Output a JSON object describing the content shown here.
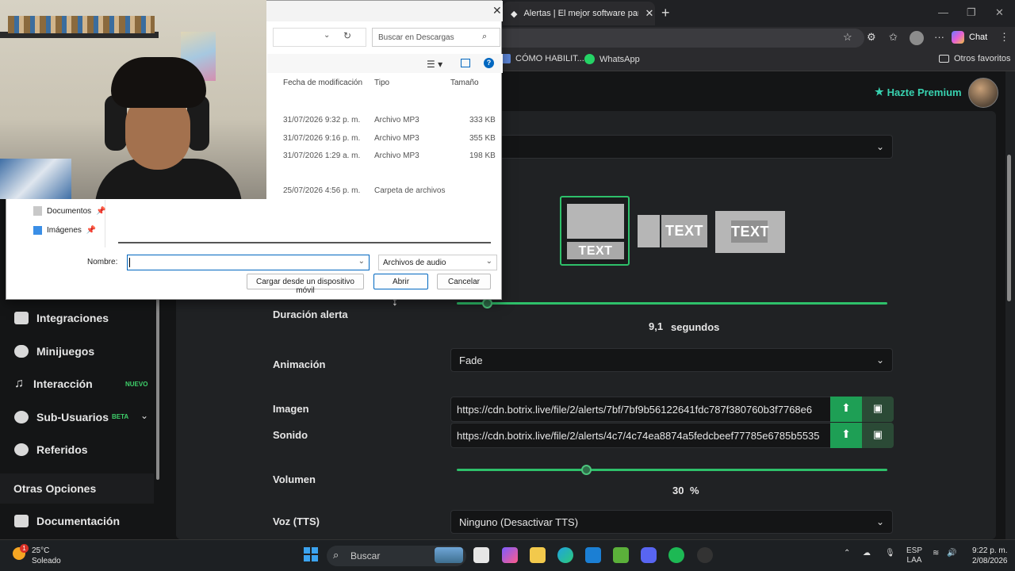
{
  "browser": {
    "tab_title": "Alertas | El mejor software para po",
    "bookmarks": [
      "CÓMO HABILIT...",
      "WhatsApp"
    ],
    "other_favorites": "Otros favoritos",
    "chat_label": "Chat"
  },
  "header": {
    "premium_label": "Hazte Premium"
  },
  "sidebar": {
    "items": [
      {
        "label": "Integraciones"
      },
      {
        "label": "Minijuegos"
      },
      {
        "label": "Interacción"
      },
      {
        "label": "Sub-Usuarios"
      },
      {
        "label": "Referidos"
      }
    ],
    "nuevo_badge": "NUEVO",
    "beta_badge": "BETA",
    "section_title": "Otras Opciones",
    "doc_item": "Documentación"
  },
  "layout_options": {
    "text_label": "TEXT"
  },
  "form": {
    "duracion_label": "Duración alerta",
    "duracion_value": "9,1",
    "duracion_unit": "segundos",
    "duracion_fraction": 0.07,
    "animacion_label": "Animación",
    "animacion_value": "Fade",
    "imagen_label": "Imagen",
    "imagen_url": "https://cdn.botrix.live/file/2/alerts/7bf/7bf9b56122641fdc787f380760b3f7768e6",
    "sonido_label": "Sonido",
    "sonido_url": "https://cdn.botrix.live/file/2/alerts/4c7/4c74ea8874a5fedcbeef77785e6785b5535",
    "volumen_label": "Volumen",
    "volumen_value": "30",
    "volumen_unit": "%",
    "volumen_fraction": 0.3,
    "voz_label": "Voz (TTS)",
    "voz_value": "Ninguno (Desactivar TTS)"
  },
  "dialog": {
    "search_placeholder": "Buscar en Descargas",
    "columns": [
      "Fecha de modificación",
      "Tipo",
      "Tamaño"
    ],
    "rows": [
      {
        "date": "31/07/2026 9:32 p. m.",
        "type": "Archivo MP3",
        "size": "333 KB"
      },
      {
        "date": "31/07/2026 9:16 p. m.",
        "type": "Archivo MP3",
        "size": "355 KB"
      },
      {
        "date": "31/07/2026 1:29 a. m.",
        "type": "Archivo MP3",
        "size": "198 KB"
      },
      {
        "date": "25/07/2026 4:56 p. m.",
        "type": "Carpeta de archivos",
        "size": ""
      }
    ],
    "nav": [
      "Documentos",
      "Imágenes"
    ],
    "name_label": "Nombre:",
    "name_value": "",
    "filetype": "Archivos de audio",
    "mobile_button": "Cargar desde un dispositivo móvil",
    "open_button": "Abrir",
    "cancel_button": "Cancelar"
  },
  "taskbar": {
    "temperature": "25°C",
    "weather": "Soleado",
    "search": "Buscar",
    "lang1": "ESP",
    "lang2": "LAA",
    "time": "9:22 p. m.",
    "date": "2/08/2026",
    "notification_count": "1"
  },
  "colors": {
    "accent": "#2ec06a",
    "premium": "#38d2b0",
    "dialog_blue": "#0067c0"
  }
}
